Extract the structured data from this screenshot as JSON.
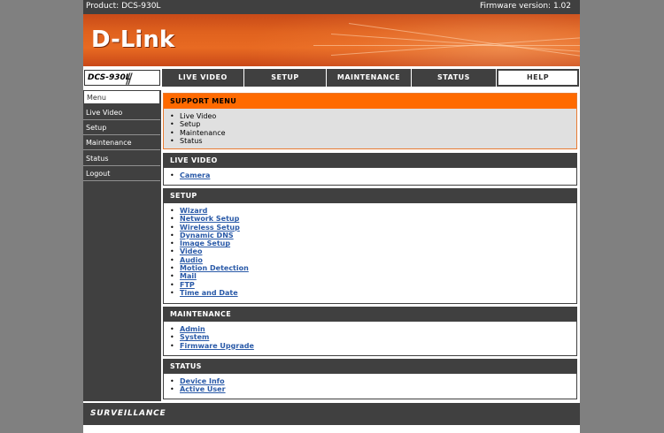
{
  "topbar": {
    "product": "Product: DCS-930L",
    "firmware": "Firmware version: 1.02"
  },
  "brand": {
    "logo": "D-Link",
    "model": "DCS-930L",
    "model_slashes": "//",
    "accent_color": "#ff6a00",
    "dark_color": "#404040"
  },
  "nav": {
    "tabs": [
      {
        "label": "LIVE VIDEO"
      },
      {
        "label": "SETUP"
      },
      {
        "label": "MAINTENANCE"
      },
      {
        "label": "STATUS"
      },
      {
        "label": "HELP",
        "active": true
      }
    ]
  },
  "sidebar": {
    "items": [
      {
        "label": "Menu",
        "active": true
      },
      {
        "label": "Live Video"
      },
      {
        "label": "Setup"
      },
      {
        "label": "Maintenance"
      },
      {
        "label": "Status"
      },
      {
        "label": "Logout"
      }
    ]
  },
  "support_menu": {
    "title": "SUPPORT MENU",
    "items": [
      "Live Video",
      "Setup",
      "Maintenance",
      "Status"
    ]
  },
  "sections": {
    "live_video": {
      "title": "LIVE VIDEO",
      "links": [
        "Camera"
      ]
    },
    "setup": {
      "title": "SETUP",
      "links": [
        "Wizard",
        "Network Setup",
        "Wireless Setup",
        "Dynamic DNS",
        "Image Setup",
        "Video",
        "Audio",
        "Motion Detection",
        "Mail",
        "FTP",
        "Time and Date"
      ]
    },
    "maintenance": {
      "title": "MAINTENANCE",
      "links": [
        "Admin",
        "System",
        "Firmware Upgrade"
      ]
    },
    "status": {
      "title": "STATUS",
      "links": [
        "Device Info",
        "Active User"
      ]
    }
  },
  "footer": {
    "brand": "SURVEILLANCE"
  }
}
